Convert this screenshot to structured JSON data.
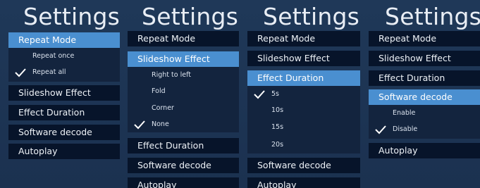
{
  "screen_title": "Settings",
  "menu_labels": {
    "repeat_mode": "Repeat Mode",
    "slideshow_effect": "Slideshow Effect",
    "effect_duration": "Effect Duration",
    "software_decode": "Software decode",
    "autoplay": "Autoplay"
  },
  "repeat_mode_options": [
    "Repeat once",
    "Repeat all"
  ],
  "repeat_mode_selected": "Repeat all",
  "slideshow_effect_options": [
    "Right to left",
    "Fold",
    "Corner",
    "None"
  ],
  "slideshow_effect_selected": "None",
  "effect_duration_options": [
    "5s",
    "10s",
    "15s",
    "20s"
  ],
  "effect_duration_selected": "5s",
  "software_decode_options": [
    "Enable",
    "Disable"
  ],
  "software_decode_selected": "Disable",
  "colors": {
    "background": "#1d3454",
    "menu_item": "#07142a",
    "selected_item": "#4a8fd0",
    "submenu": "#13243e",
    "text": "#eef2f7"
  },
  "icons": {
    "check": "check-icon"
  }
}
